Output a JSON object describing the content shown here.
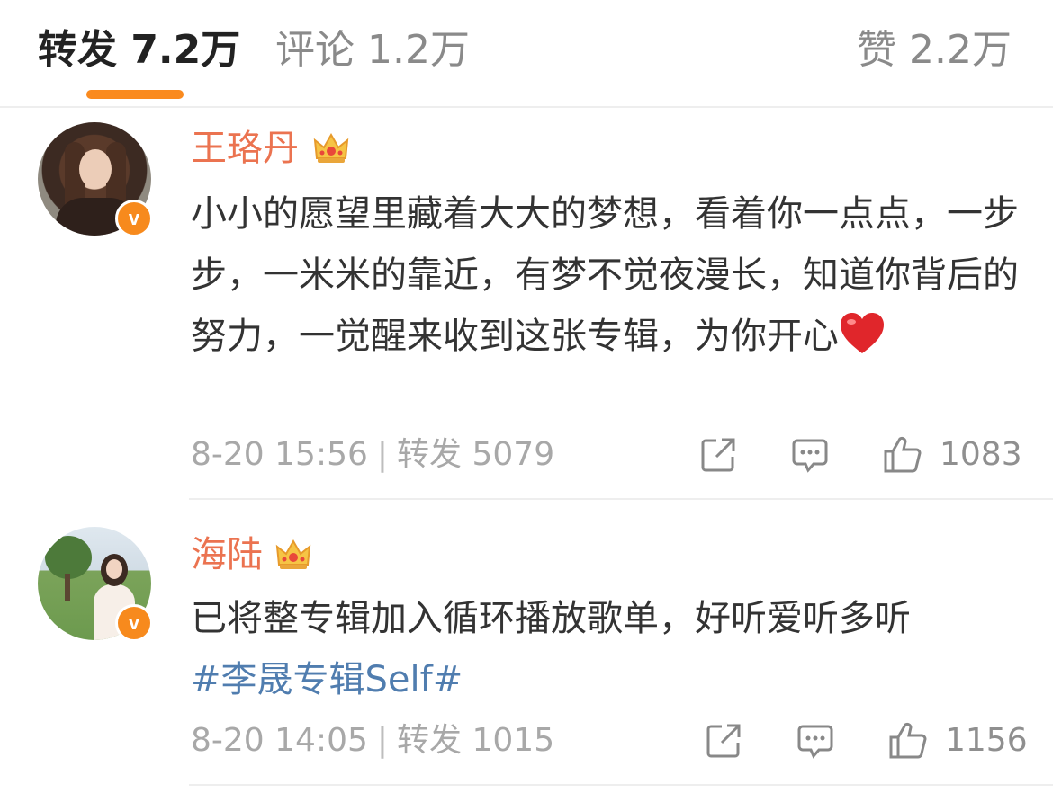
{
  "tabs": {
    "repost": "转发 7.2万",
    "comment": "评论 1.2万",
    "like": "赞 2.2万",
    "active": "repost"
  },
  "accent_color": "#fa8a1e",
  "username_color": "#eb7350",
  "hashtag_color": "#507daf",
  "comments": [
    {
      "username": "王珞丹",
      "badge": "crown-icon",
      "verified": "v",
      "text": "小小的愿望里藏着大大的梦想，看着你一点点，一步步，一米米的靠近，有梦不觉夜漫长，知道你背后的努力，一觉醒来收到这张专辑，为你开心",
      "emoji": "heart-emoji",
      "time": "8-20 15:56",
      "separator": "|",
      "repost_label": "转发 5079",
      "like_count": "1083"
    },
    {
      "username": "海陆",
      "badge": "crown-icon",
      "verified": "v",
      "text": "已将整专辑加入循环播放歌单，好听爱听多听",
      "hashtag": "#李晟专辑Self#",
      "time": "8-20 14:05",
      "separator": "|",
      "repost_label": "转发 1015",
      "like_count": "1156"
    }
  ]
}
